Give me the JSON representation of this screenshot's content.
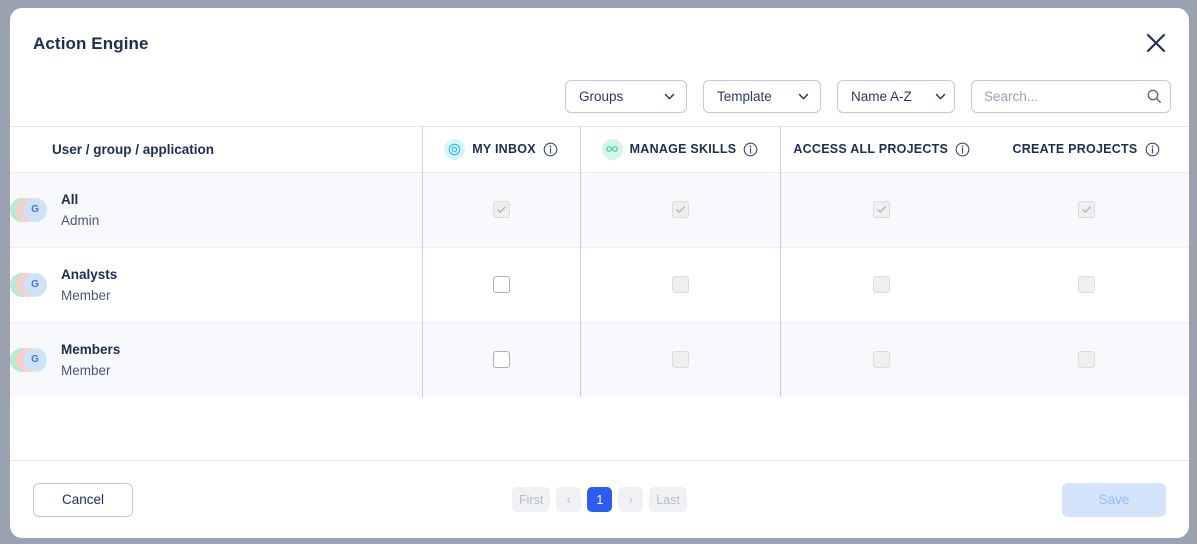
{
  "dialog": {
    "title": "Action Engine",
    "close_icon": "close-icon"
  },
  "toolbar": {
    "filters": [
      {
        "name": "groups",
        "value": "Groups"
      },
      {
        "name": "template",
        "value": "Template"
      },
      {
        "name": "sort",
        "value": "Name A-Z"
      }
    ],
    "search": {
      "placeholder": "Search...",
      "value": "",
      "icon": "search-icon"
    }
  },
  "table": {
    "name_column_header": "User / group / application",
    "permission_columns": [
      {
        "label": "MY INBOX",
        "icon": "eye-icon",
        "chip_color": "#d5f4fb",
        "glyph_color": "#29bfe0",
        "info": "info-icon",
        "enabled": true
      },
      {
        "label": "MANAGE SKILLS",
        "icon": "glasses-icon",
        "chip_color": "#d2f6e7",
        "glyph_color": "#2ec79a",
        "info": "info-icon",
        "enabled": false
      },
      {
        "label": "ACCESS ALL PROJECTS",
        "icon": "",
        "info": "info-icon",
        "enabled": false
      },
      {
        "label": "CREATE PROJECTS",
        "icon": "",
        "info": "info-icon",
        "enabled": false
      }
    ],
    "rows": [
      {
        "avatar_initial": "G",
        "name": "All",
        "role": "Admin",
        "checks": [
          {
            "checked": true,
            "disabled": true
          },
          {
            "checked": true,
            "disabled": true
          },
          {
            "checked": true,
            "disabled": true
          },
          {
            "checked": true,
            "disabled": true
          }
        ]
      },
      {
        "avatar_initial": "G",
        "name": "Analysts",
        "role": "Member",
        "checks": [
          {
            "checked": false,
            "disabled": false
          },
          {
            "checked": false,
            "disabled": true
          },
          {
            "checked": false,
            "disabled": true
          },
          {
            "checked": false,
            "disabled": true
          }
        ]
      },
      {
        "avatar_initial": "G",
        "name": "Members",
        "role": "Member",
        "checks": [
          {
            "checked": false,
            "disabled": false
          },
          {
            "checked": false,
            "disabled": true
          },
          {
            "checked": false,
            "disabled": true
          },
          {
            "checked": false,
            "disabled": true
          }
        ]
      }
    ]
  },
  "footer": {
    "cancel_label": "Cancel",
    "save_label": "Save",
    "pagination": {
      "first_label": "First",
      "prev_label": "‹",
      "pages": [
        "1"
      ],
      "current_page": "1",
      "next_label": "›",
      "last_label": "Last"
    }
  },
  "colors": {
    "accent": "#2f5bf5",
    "title": "#1e2d52",
    "backdrop": "#9aa2b1",
    "save_disabled_bg": "#d3e4fb"
  }
}
